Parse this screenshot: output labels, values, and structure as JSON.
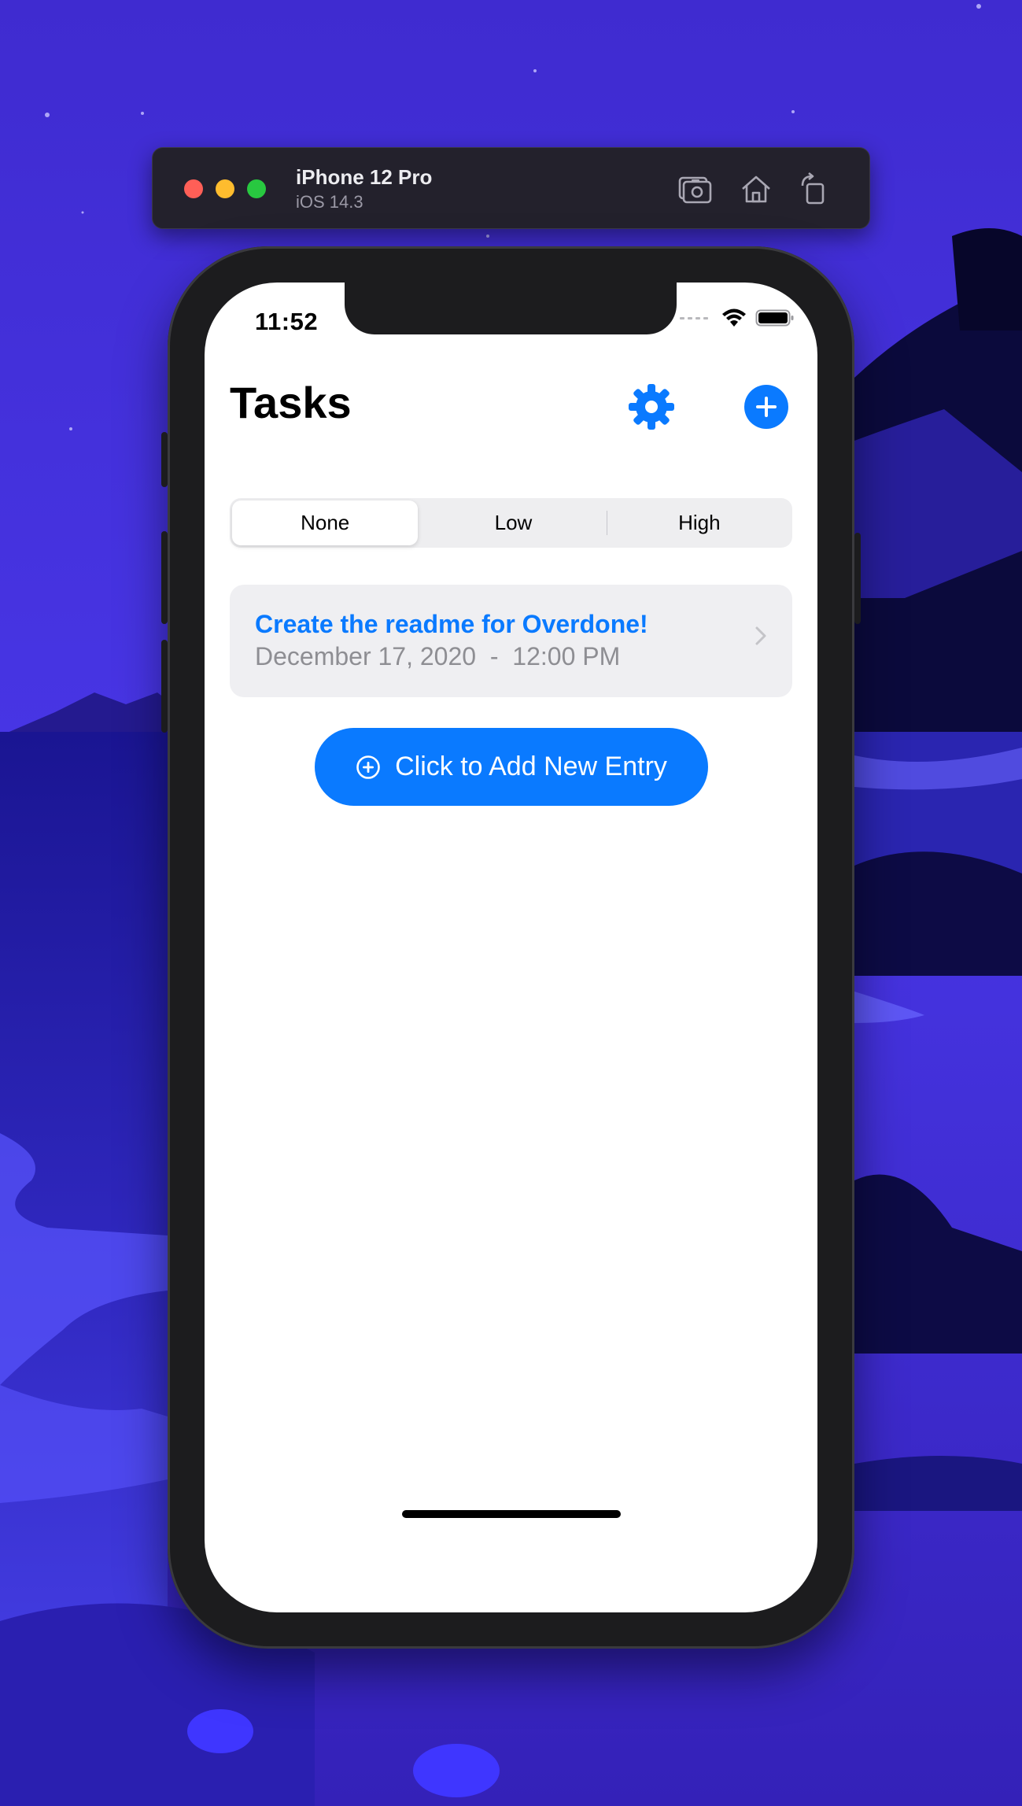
{
  "simulator": {
    "device_name": "iPhone 12 Pro",
    "os_version": "iOS 14.3",
    "icons": [
      "screenshot-icon",
      "home-icon",
      "rotate-icon"
    ]
  },
  "status_bar": {
    "time": "11:52",
    "icons": [
      "cellular-icon",
      "wifi-icon",
      "battery-icon"
    ]
  },
  "nav": {
    "title": "Tasks",
    "settings_icon": "gear-icon",
    "add_icon": "plus-circle-icon"
  },
  "filter": {
    "segments": [
      "None",
      "Low",
      "High"
    ],
    "selected": "None"
  },
  "tasks": [
    {
      "title": "Create the readme for Overdone!",
      "date": "December 17, 2020  -  12:00 PM"
    }
  ],
  "add_entry": {
    "label": "Click to Add New Entry",
    "icon": "plus-circle-outline-icon"
  },
  "colors": {
    "accent": "#0a7aff",
    "wallpaper": "#3a28c9",
    "secondary_text": "#8e8e93"
  }
}
